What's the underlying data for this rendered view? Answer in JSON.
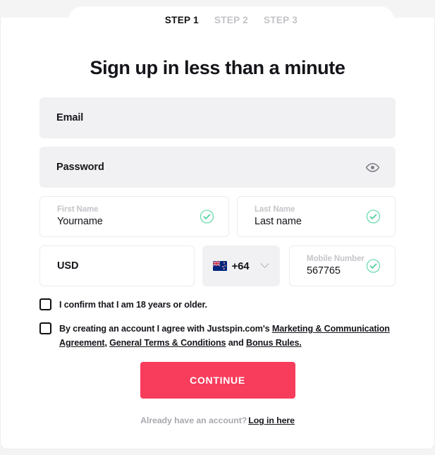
{
  "steps": {
    "tabs": [
      {
        "label": "STEP 1",
        "active": true
      },
      {
        "label": "STEP 2",
        "active": false
      },
      {
        "label": "STEP 3",
        "active": false
      }
    ]
  },
  "headline": "Sign up in less than a minute",
  "form": {
    "email": {
      "placeholder": "Email",
      "value": ""
    },
    "password": {
      "placeholder": "Password",
      "value": "",
      "toggle_icon": "eye-icon"
    },
    "first_name": {
      "label": "First Name",
      "value": "Yourname",
      "status_icon": "check-circle-icon"
    },
    "last_name": {
      "label": "Last Name",
      "value": "Last name",
      "status_icon": "check-circle-icon"
    },
    "currency": {
      "value": "USD"
    },
    "country_code": {
      "dial_code": "+64",
      "flag": "new-zealand-flag",
      "chevron_icon": "chevron-down-icon"
    },
    "mobile": {
      "label": "Mobile Number",
      "value": "567765",
      "status_icon": "check-circle-icon"
    }
  },
  "consents": {
    "age": {
      "checked": false,
      "text_before": "I confirm that I am ",
      "bold_part": "18",
      "text_after": " years or older."
    },
    "terms": {
      "checked": false,
      "intro": "By creating an account I agree with Justspin.com's ",
      "link_1": "Marketing & Communication Agreement",
      "separator_1": ", ",
      "link_2": "General Terms & Conditions",
      "separator_2": " and ",
      "link_3": "Bonus Rules.",
      "full_text": "By creating an account I agree with Justspin.com's Marketing & Communication Agreement, General Terms & Conditions and Bonus Rules."
    }
  },
  "cta": {
    "label": "CONTINUE",
    "color": "#f73c5c"
  },
  "footer": {
    "prompt": "Already have an account?",
    "link": "Log in here"
  },
  "colors": {
    "accent": "#f73c5c",
    "field_grey": "#f1f1f3",
    "valid_green": "#5fd9a9",
    "page_background": "#f4f4f5"
  }
}
